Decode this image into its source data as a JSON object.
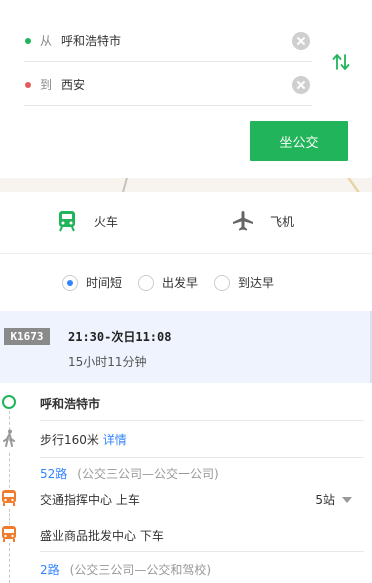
{
  "search": {
    "from_prefix": "从",
    "from_value": "呼和浩特市",
    "to_prefix": "到",
    "to_value": "西安",
    "submit_label": "坐公交"
  },
  "modes": [
    {
      "label": "火车",
      "icon": "train-icon"
    },
    {
      "label": "飞机",
      "icon": "airplane-icon"
    }
  ],
  "sort_options": [
    {
      "label": "时间短",
      "selected": true
    },
    {
      "label": "出发早",
      "selected": false
    },
    {
      "label": "到达早",
      "selected": false
    }
  ],
  "train": {
    "number": "K1673",
    "time": "21:30-次日11:08",
    "duration": "15小时11分钟"
  },
  "steps": {
    "origin": "呼和浩特市",
    "walk_text": "步行160米",
    "walk_link": "详情",
    "route1_no": "52路",
    "route1_sub": "(公交三公司—公交一公司)",
    "board": "交通指挥中心 上车",
    "board_stops": "5站",
    "alight": "盛业商品批发中心 下车",
    "route2_no": "2路",
    "route2_sub": "(公交三公司—公交和驾校)"
  },
  "colors": {
    "accent_green": "#21b45a",
    "link_blue": "#3385ff",
    "from_dot": "#21b45a",
    "to_dot": "#e85a5a",
    "bus_orange": "#f07b2a"
  }
}
